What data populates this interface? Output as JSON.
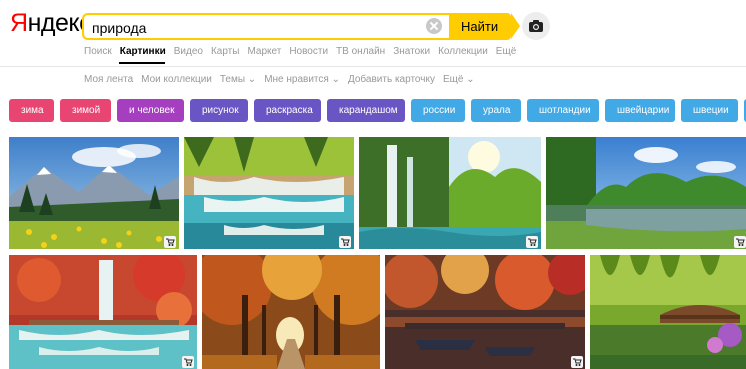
{
  "logo": {
    "first": "Я",
    "rest": "ндекс"
  },
  "search": {
    "value": "природа",
    "button": "Найти"
  },
  "services": [
    "Поиск",
    "Картинки",
    "Видео",
    "Карты",
    "Маркет",
    "Новости",
    "ТВ онлайн",
    "Знатоки",
    "Коллекции",
    "Ещё"
  ],
  "subnav": [
    "Моя лента",
    "Мои коллекции",
    "Темы ⌄",
    "Мне нравится ⌄",
    "Добавить карточку",
    "Ещё ⌄"
  ],
  "chips": [
    {
      "label": "зима",
      "color": "#e94573"
    },
    {
      "label": "зимой",
      "color": "#e94573"
    },
    {
      "label": "и человек",
      "color": "#a53fbf"
    },
    {
      "label": "рисунок",
      "color": "#6a55c4"
    },
    {
      "label": "раскраска",
      "color": "#6a55c4"
    },
    {
      "label": "карандашом",
      "color": "#6a55c4"
    },
    {
      "label": "россии",
      "color": "#40a9e6"
    },
    {
      "label": "урала",
      "color": "#40a9e6"
    },
    {
      "label": "шотландии",
      "color": "#40a9e6"
    },
    {
      "label": "швейцарии",
      "color": "#40a9e6"
    },
    {
      "label": "швеции",
      "color": "#40a9e6"
    }
  ],
  "images": [
    {
      "name": "image-mountain-meadow"
    },
    {
      "name": "image-waterfall-cascade"
    },
    {
      "name": "image-forest-waterfall"
    },
    {
      "name": "image-lake-forest"
    },
    {
      "name": "image-autumn-waterfall"
    },
    {
      "name": "image-autumn-alley"
    },
    {
      "name": "image-autumn-lake-boats"
    },
    {
      "name": "image-garden-bridge"
    }
  ]
}
